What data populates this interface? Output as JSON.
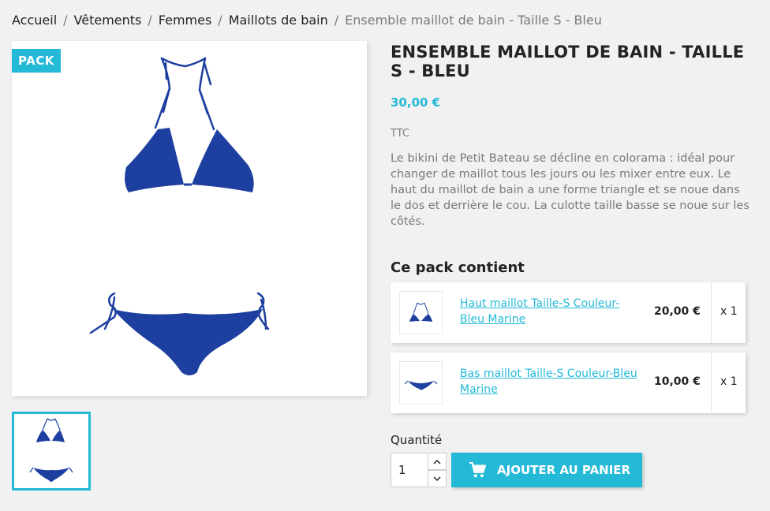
{
  "breadcrumb": {
    "items": [
      "Accueil",
      "Vêtements",
      "Femmes",
      "Maillots de bain"
    ],
    "current": "Ensemble maillot de bain - Taille S - Bleu"
  },
  "product": {
    "flag": "PACK",
    "title": "Ensemble maillot de bain - Taille S - Bleu",
    "price": "30,00 €",
    "tax_label": "TTC",
    "description": "Le bikini de Petit Bateau se décline en colorama : idéal pour changer de maillot tous les jours ou les mixer entre eux. Le haut du maillot de bain a une forme triangle et se noue dans le dos et derrière le cou. La culotte taille basse se noue sur les côtés."
  },
  "pack": {
    "heading": "Ce pack contient",
    "items": [
      {
        "name": "Haut maillot Taille-S Couleur-Bleu Marine",
        "price": "20,00 €",
        "qty": "x 1"
      },
      {
        "name": "Bas maillot Taille-S Couleur-Bleu Marine",
        "price": "10,00 €",
        "qty": "x 1"
      }
    ]
  },
  "purchase": {
    "quantity_label": "Quantité",
    "quantity_value": "1",
    "add_to_cart_label": "Ajouter au panier"
  },
  "colors": {
    "accent": "#24b9d7",
    "bikini": "#1d3fa0"
  },
  "icons": {
    "cart": "shopping-cart-icon",
    "up": "chevron-up-icon",
    "down": "chevron-down-icon"
  }
}
